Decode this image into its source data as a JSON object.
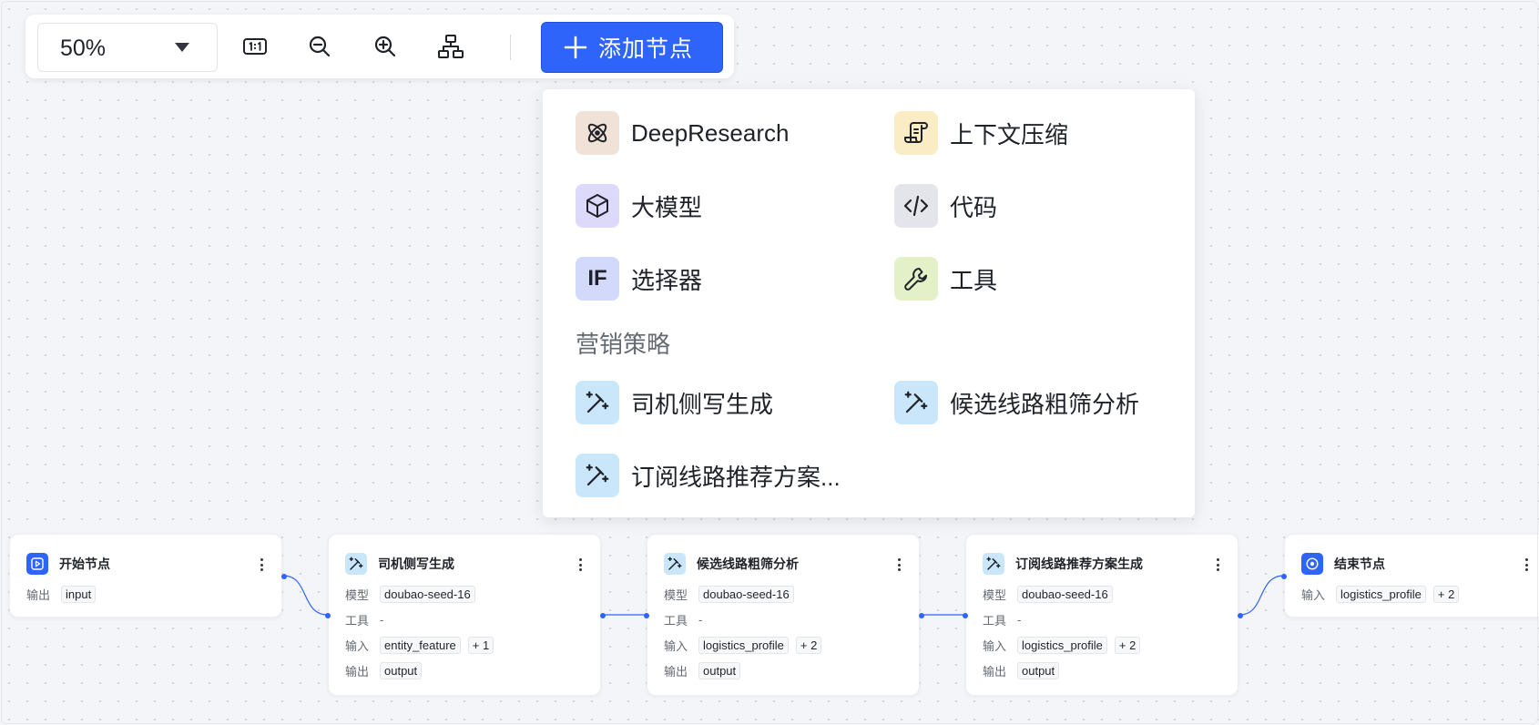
{
  "toolbar": {
    "zoom_value": "50%",
    "add_node_label": "添加节点"
  },
  "menu": {
    "items": [
      {
        "label": "DeepResearch",
        "icon": "atom-icon",
        "bg": "#f0e2d6"
      },
      {
        "label": "上下文压缩",
        "icon": "scroll-icon",
        "bg": "#faecc4"
      },
      {
        "label": "大模型",
        "icon": "cube-icon",
        "bg": "#dcd9fb"
      },
      {
        "label": "代码",
        "icon": "code-icon",
        "bg": "#e3e5ea"
      },
      {
        "label": "选择器",
        "icon": "if-icon",
        "icon_text": "IF",
        "bg": "#d2d9fb"
      },
      {
        "label": "工具",
        "icon": "wrench-icon",
        "bg": "#e4f0c8"
      }
    ],
    "group_title": "营销策略",
    "group_items": [
      {
        "label": "司机侧写生成",
        "icon": "magic-wand-icon",
        "bg": "#c9e6fb"
      },
      {
        "label": "候选线路粗筛分析",
        "icon": "magic-wand-icon",
        "bg": "#c9e6fb"
      },
      {
        "label": "订阅线路推荐方案...",
        "icon": "magic-wand-icon",
        "bg": "#c9e6fb"
      }
    ]
  },
  "nodes": [
    {
      "title": "开始节点",
      "icon": "play-icon",
      "rows": [
        {
          "label": "输出",
          "tags": [
            "input"
          ]
        }
      ]
    },
    {
      "title": "司机侧写生成",
      "icon": "magic-wand-icon",
      "rows": [
        {
          "label": "模型",
          "tags": [
            "doubao-seed-16"
          ]
        },
        {
          "label": "工具",
          "value": "-"
        },
        {
          "label": "输入",
          "tags": [
            "entity_feature",
            "+ 1"
          ]
        },
        {
          "label": "输出",
          "tags": [
            "output"
          ]
        }
      ]
    },
    {
      "title": "候选线路粗筛分析",
      "icon": "magic-wand-icon",
      "rows": [
        {
          "label": "模型",
          "tags": [
            "doubao-seed-16"
          ]
        },
        {
          "label": "工具",
          "value": "-"
        },
        {
          "label": "输入",
          "tags": [
            "logistics_profile",
            "+ 2"
          ]
        },
        {
          "label": "输出",
          "tags": [
            "output"
          ]
        }
      ]
    },
    {
      "title": "订阅线路推荐方案生成",
      "icon": "magic-wand-icon",
      "rows": [
        {
          "label": "模型",
          "tags": [
            "doubao-seed-16"
          ]
        },
        {
          "label": "工具",
          "value": "-"
        },
        {
          "label": "输入",
          "tags": [
            "logistics_profile",
            "+ 2"
          ]
        },
        {
          "label": "输出",
          "tags": [
            "output"
          ]
        }
      ]
    },
    {
      "title": "结束节点",
      "icon": "target-icon",
      "rows": [
        {
          "label": "输入",
          "tags": [
            "logistics_profile",
            "+ 2"
          ]
        }
      ]
    }
  ],
  "colors": {
    "accent": "#2e64fa",
    "canvas_bg": "#f4f5f8",
    "edge": "#2e64fa"
  }
}
